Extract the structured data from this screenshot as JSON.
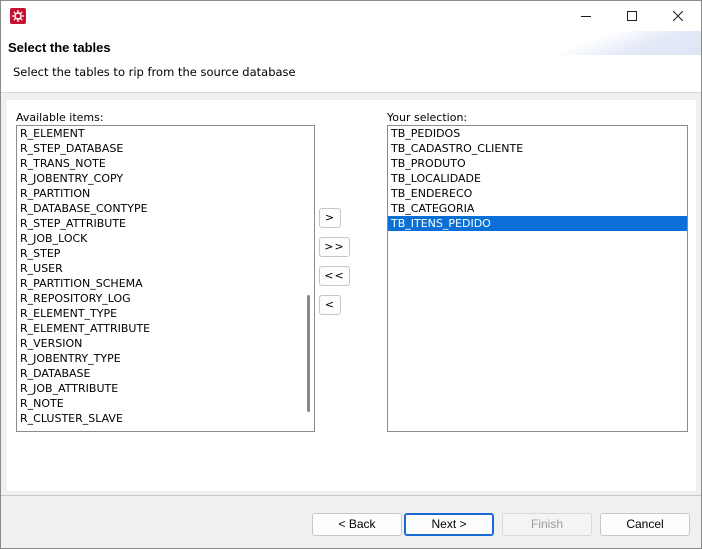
{
  "window": {
    "title": "",
    "controls": {
      "minimize": "minimize-icon",
      "maximize": "maximize-icon",
      "close": "close-icon"
    }
  },
  "header": {
    "title": "Select the tables",
    "description": "Select the tables to rip from the source database"
  },
  "available": {
    "label": "Available items:",
    "items": [
      "R_ELEMENT",
      "R_STEP_DATABASE",
      "R_TRANS_NOTE",
      "R_JOBENTRY_COPY",
      "R_PARTITION",
      "R_DATABASE_CONTYPE",
      "R_STEP_ATTRIBUTE",
      "R_JOB_LOCK",
      "R_STEP",
      "R_USER",
      "R_PARTITION_SCHEMA",
      "R_REPOSITORY_LOG",
      "R_ELEMENT_TYPE",
      "R_ELEMENT_ATTRIBUTE",
      "R_VERSION",
      "R_JOBENTRY_TYPE",
      "R_DATABASE",
      "R_JOB_ATTRIBUTE",
      "R_NOTE",
      "R_CLUSTER_SLAVE"
    ]
  },
  "selection": {
    "label": "Your selection:",
    "items": [
      "TB_PEDIDOS",
      "TB_CADASTRO_CLIENTE",
      "TB_PRODUTO",
      "TB_LOCALIDADE",
      "TB_ENDERECO",
      "TB_CATEGORIA",
      "TB_ITENS_PEDIDO"
    ],
    "selected_index": 6
  },
  "move_buttons": {
    "add": ">",
    "add_all": ">>",
    "remove_all": "<<",
    "remove": "<"
  },
  "footer": {
    "back": "< Back",
    "next": "Next >",
    "finish": "Finish",
    "cancel": "Cancel"
  },
  "colors": {
    "selection_highlight": "#0b6fd8",
    "default_button_border": "#1a6ad5",
    "app_icon": "#c8102e"
  }
}
